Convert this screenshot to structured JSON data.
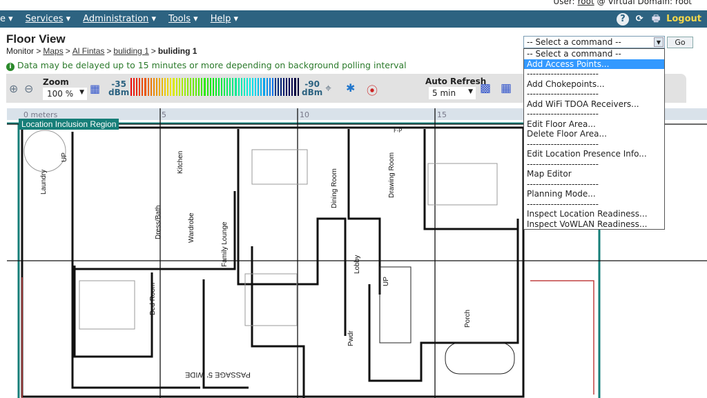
{
  "header": {
    "user_label": "User:",
    "user": "root",
    "domain_label": "@ Virtual Domain:",
    "domain": "root",
    "logout": "Logout",
    "menu": [
      {
        "label": "e"
      },
      {
        "label": "Services"
      },
      {
        "label": "Administration"
      },
      {
        "label": "Tools"
      },
      {
        "label": "Help"
      }
    ]
  },
  "page": {
    "title": "Floor View",
    "breadcrumb": [
      "Monitor",
      "Maps",
      "Al Fintas",
      "buliding 1"
    ],
    "breadcrumb_current": "buliding 1",
    "notice": "Data may be delayed up to 15 minutes or more depending on background polling interval"
  },
  "toolbar": {
    "zoom_label": "Zoom",
    "zoom_value": "100 %",
    "dbm_high": "-35",
    "dbm_low": "-90",
    "dbm_unit": "dBm",
    "auto_refresh_label": "Auto Refresh",
    "auto_refresh_value": "5 min"
  },
  "command": {
    "selected": "-- Select a command --",
    "go": "Go",
    "options": [
      "-- Select a command --",
      "Add Access Points...",
      "------------------------",
      "Add Chokepoints...",
      "------------------------",
      "Add WiFi TDOA Receivers...",
      "------------------------",
      "Edit Floor Area...",
      "Delete Floor Area...",
      "------------------------",
      "Edit Location Presence Info...",
      "------------------------",
      "Map Editor",
      "------------------------",
      "Planning Mode...",
      "------------------------",
      "Inspect Location Readiness...",
      "Inspect VoWLAN Readiness..."
    ],
    "highlighted_index": 1
  },
  "map": {
    "ruler": [
      "0 meters",
      "5",
      "10",
      "15"
    ],
    "region_label": "Location Inclusion Region",
    "rooms": [
      "Laundry",
      "UP",
      "Kitchen",
      "Dress/Bath",
      "Wardrobe",
      "Family Lounge",
      "Bed Room",
      "Dining Room",
      "Drawing Room",
      "Lobby",
      "UP",
      "Pwdr",
      "Porch",
      "PASSAGE 5' WIDE",
      "F-P"
    ],
    "colors": {
      "region": "#167e78",
      "grid": "#000000",
      "nav": "#2d6381"
    }
  }
}
